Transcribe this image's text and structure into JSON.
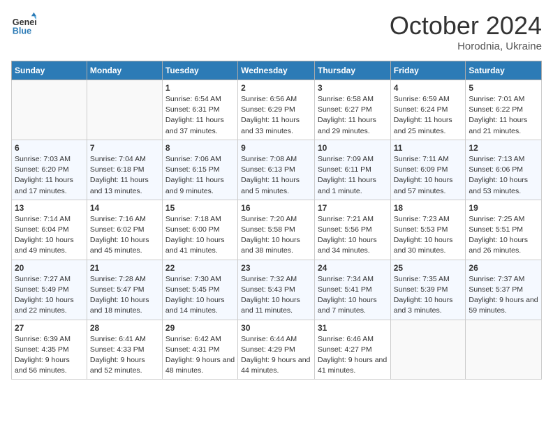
{
  "header": {
    "logo_line1": "General",
    "logo_line2": "Blue",
    "month_title": "October 2024",
    "subtitle": "Horodnia, Ukraine"
  },
  "days_of_week": [
    "Sunday",
    "Monday",
    "Tuesday",
    "Wednesday",
    "Thursday",
    "Friday",
    "Saturday"
  ],
  "weeks": [
    [
      {
        "day": "",
        "info": ""
      },
      {
        "day": "",
        "info": ""
      },
      {
        "day": "1",
        "info": "Sunrise: 6:54 AM\nSunset: 6:31 PM\nDaylight: 11 hours and 37 minutes."
      },
      {
        "day": "2",
        "info": "Sunrise: 6:56 AM\nSunset: 6:29 PM\nDaylight: 11 hours and 33 minutes."
      },
      {
        "day": "3",
        "info": "Sunrise: 6:58 AM\nSunset: 6:27 PM\nDaylight: 11 hours and 29 minutes."
      },
      {
        "day": "4",
        "info": "Sunrise: 6:59 AM\nSunset: 6:24 PM\nDaylight: 11 hours and 25 minutes."
      },
      {
        "day": "5",
        "info": "Sunrise: 7:01 AM\nSunset: 6:22 PM\nDaylight: 11 hours and 21 minutes."
      }
    ],
    [
      {
        "day": "6",
        "info": "Sunrise: 7:03 AM\nSunset: 6:20 PM\nDaylight: 11 hours and 17 minutes."
      },
      {
        "day": "7",
        "info": "Sunrise: 7:04 AM\nSunset: 6:18 PM\nDaylight: 11 hours and 13 minutes."
      },
      {
        "day": "8",
        "info": "Sunrise: 7:06 AM\nSunset: 6:15 PM\nDaylight: 11 hours and 9 minutes."
      },
      {
        "day": "9",
        "info": "Sunrise: 7:08 AM\nSunset: 6:13 PM\nDaylight: 11 hours and 5 minutes."
      },
      {
        "day": "10",
        "info": "Sunrise: 7:09 AM\nSunset: 6:11 PM\nDaylight: 11 hours and 1 minute."
      },
      {
        "day": "11",
        "info": "Sunrise: 7:11 AM\nSunset: 6:09 PM\nDaylight: 10 hours and 57 minutes."
      },
      {
        "day": "12",
        "info": "Sunrise: 7:13 AM\nSunset: 6:06 PM\nDaylight: 10 hours and 53 minutes."
      }
    ],
    [
      {
        "day": "13",
        "info": "Sunrise: 7:14 AM\nSunset: 6:04 PM\nDaylight: 10 hours and 49 minutes."
      },
      {
        "day": "14",
        "info": "Sunrise: 7:16 AM\nSunset: 6:02 PM\nDaylight: 10 hours and 45 minutes."
      },
      {
        "day": "15",
        "info": "Sunrise: 7:18 AM\nSunset: 6:00 PM\nDaylight: 10 hours and 41 minutes."
      },
      {
        "day": "16",
        "info": "Sunrise: 7:20 AM\nSunset: 5:58 PM\nDaylight: 10 hours and 38 minutes."
      },
      {
        "day": "17",
        "info": "Sunrise: 7:21 AM\nSunset: 5:56 PM\nDaylight: 10 hours and 34 minutes."
      },
      {
        "day": "18",
        "info": "Sunrise: 7:23 AM\nSunset: 5:53 PM\nDaylight: 10 hours and 30 minutes."
      },
      {
        "day": "19",
        "info": "Sunrise: 7:25 AM\nSunset: 5:51 PM\nDaylight: 10 hours and 26 minutes."
      }
    ],
    [
      {
        "day": "20",
        "info": "Sunrise: 7:27 AM\nSunset: 5:49 PM\nDaylight: 10 hours and 22 minutes."
      },
      {
        "day": "21",
        "info": "Sunrise: 7:28 AM\nSunset: 5:47 PM\nDaylight: 10 hours and 18 minutes."
      },
      {
        "day": "22",
        "info": "Sunrise: 7:30 AM\nSunset: 5:45 PM\nDaylight: 10 hours and 14 minutes."
      },
      {
        "day": "23",
        "info": "Sunrise: 7:32 AM\nSunset: 5:43 PM\nDaylight: 10 hours and 11 minutes."
      },
      {
        "day": "24",
        "info": "Sunrise: 7:34 AM\nSunset: 5:41 PM\nDaylight: 10 hours and 7 minutes."
      },
      {
        "day": "25",
        "info": "Sunrise: 7:35 AM\nSunset: 5:39 PM\nDaylight: 10 hours and 3 minutes."
      },
      {
        "day": "26",
        "info": "Sunrise: 7:37 AM\nSunset: 5:37 PM\nDaylight: 9 hours and 59 minutes."
      }
    ],
    [
      {
        "day": "27",
        "info": "Sunrise: 6:39 AM\nSunset: 4:35 PM\nDaylight: 9 hours and 56 minutes."
      },
      {
        "day": "28",
        "info": "Sunrise: 6:41 AM\nSunset: 4:33 PM\nDaylight: 9 hours and 52 minutes."
      },
      {
        "day": "29",
        "info": "Sunrise: 6:42 AM\nSunset: 4:31 PM\nDaylight: 9 hours and 48 minutes."
      },
      {
        "day": "30",
        "info": "Sunrise: 6:44 AM\nSunset: 4:29 PM\nDaylight: 9 hours and 44 minutes."
      },
      {
        "day": "31",
        "info": "Sunrise: 6:46 AM\nSunset: 4:27 PM\nDaylight: 9 hours and 41 minutes."
      },
      {
        "day": "",
        "info": ""
      },
      {
        "day": "",
        "info": ""
      }
    ]
  ]
}
